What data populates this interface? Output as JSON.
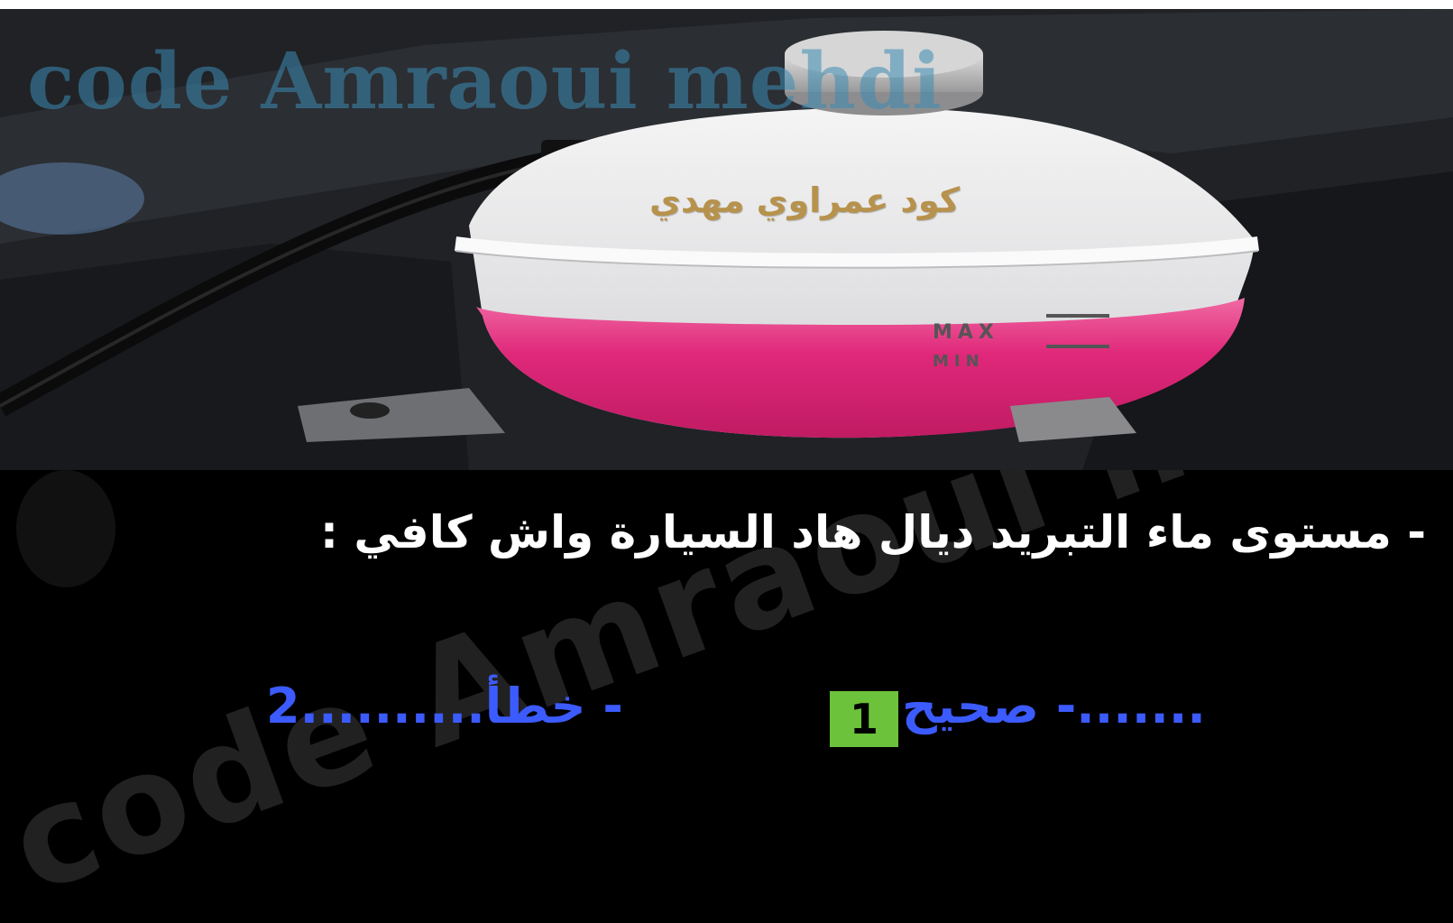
{
  "photo": {
    "watermark": "code Amraoui mehdi",
    "tank_label": "كود عمراوي مهدي",
    "level_marks": [
      "MAX",
      "MIN"
    ],
    "coolant_color": "#e0287a"
  },
  "quiz": {
    "question": "- مستوى ماء التبريد ديال هاد السيارة واش كافي :",
    "answers": [
      {
        "label": "- صحيح",
        "dots": ".......",
        "number": "1"
      },
      {
        "label": "- خطأ",
        "dots": "..........",
        "number": "2"
      }
    ],
    "selected_answer_badge": "1",
    "badge_color": "#6cc23a",
    "answer_color": "#3c5bff",
    "watermark": "code Amraoui mehdi"
  }
}
